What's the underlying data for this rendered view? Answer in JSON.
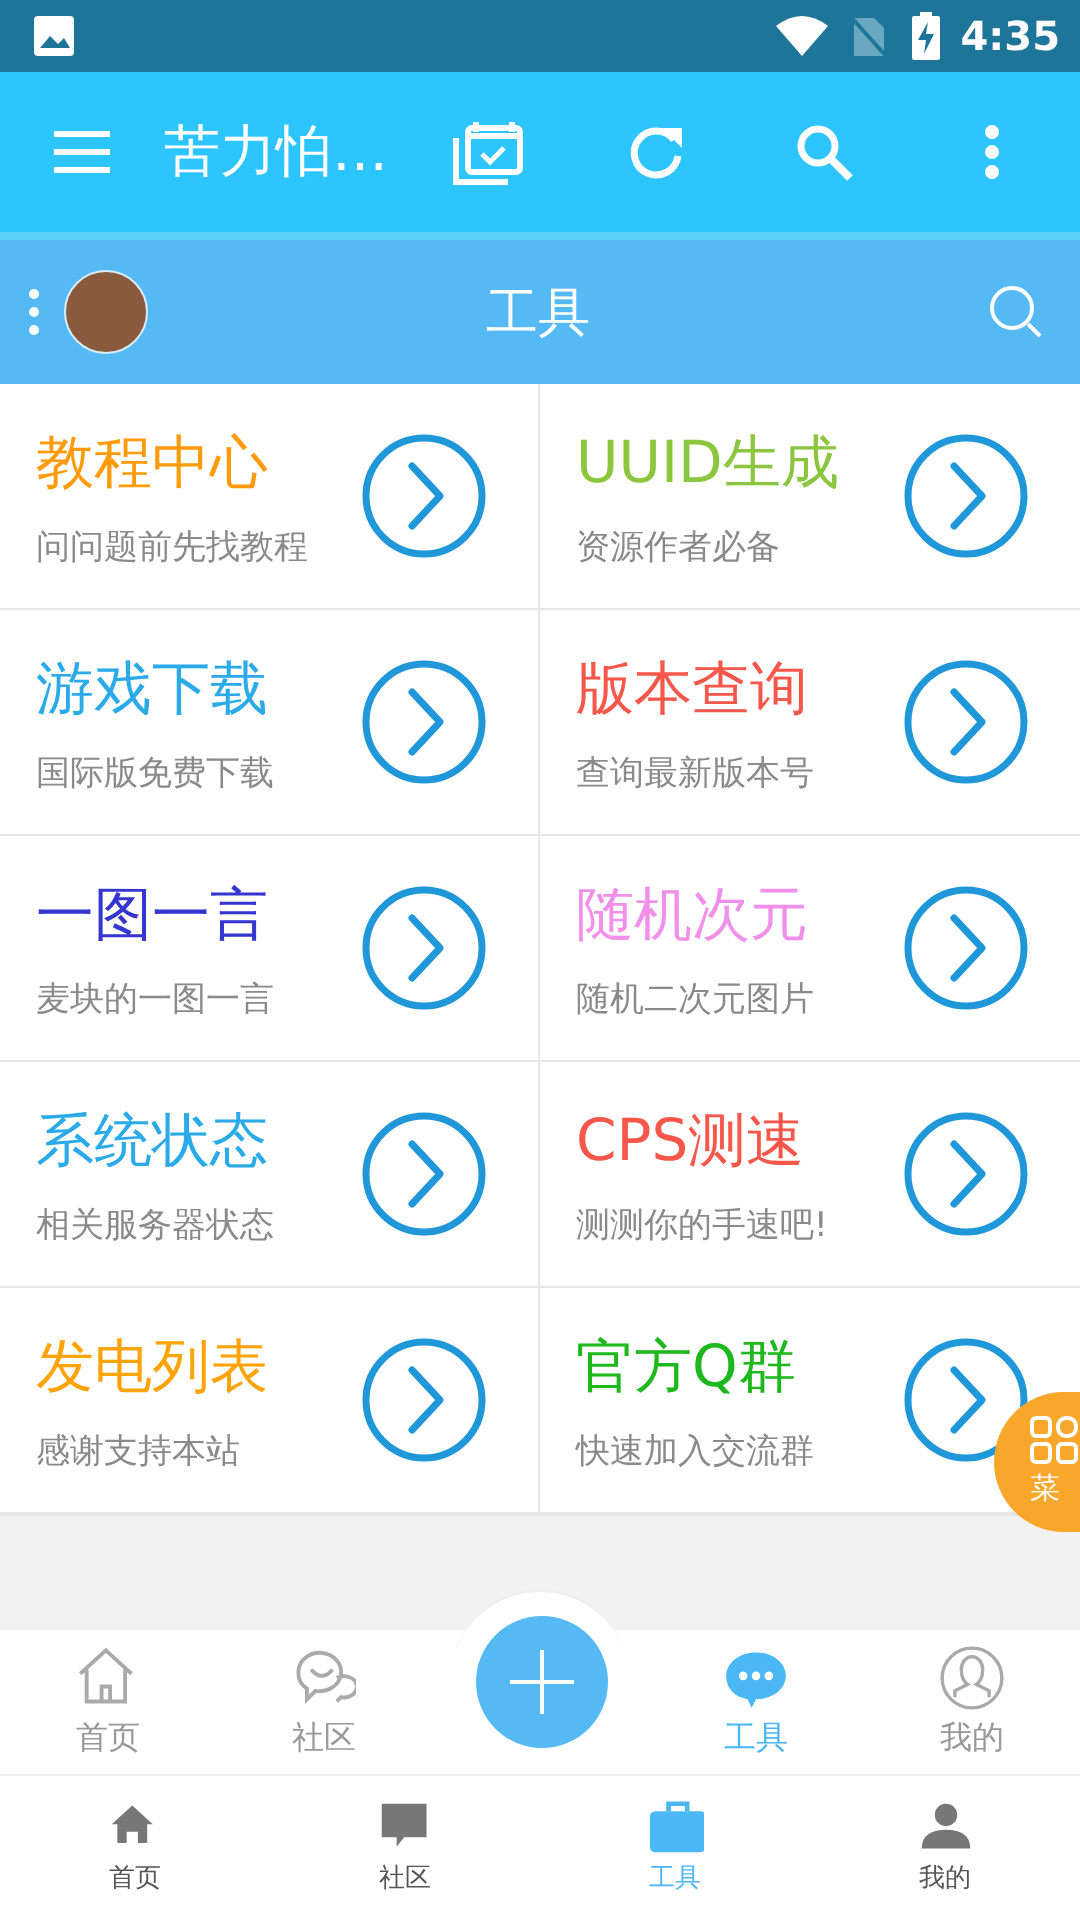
{
  "status_bar": {
    "time": "4:35"
  },
  "toolbar": {
    "title": "苦力怕…"
  },
  "sub_header": {
    "title": "工具"
  },
  "tools": [
    {
      "title": "教程中心",
      "subtitle": "问问题前先找教程",
      "color": "#ff9b0a"
    },
    {
      "title": "UUID生成",
      "subtitle": "资源作者必备",
      "color": "#8cc63f"
    },
    {
      "title": "游戏下载",
      "subtitle": "国际版免费下载",
      "color": "#2aaae8"
    },
    {
      "title": "版本查询",
      "subtitle": "查询最新版本号",
      "color": "#f5584a"
    },
    {
      "title": "一图一言",
      "subtitle": "麦块的一图一言",
      "color": "#3535d0"
    },
    {
      "title": "随机次元",
      "subtitle": "随机二次元图片",
      "color": "#f090ea"
    },
    {
      "title": "系统状态",
      "subtitle": "相关服务器状态",
      "color": "#2aaae8"
    },
    {
      "title": "CPS测速",
      "subtitle": "测测你的手速吧!",
      "color": "#f5584a"
    },
    {
      "title": "发电列表",
      "subtitle": "感谢支持本站",
      "color": "#ffa30a"
    },
    {
      "title": "官方Q群",
      "subtitle": "快速加入交流群",
      "color": "#1cb81c"
    }
  ],
  "floating_menu": {
    "label": "菜"
  },
  "tab_bar": [
    {
      "label": "首页",
      "kind": "home",
      "selected": false
    },
    {
      "label": "社区",
      "kind": "chat",
      "selected": false
    },
    {
      "label": "工具",
      "kind": "bubble",
      "selected": true
    },
    {
      "label": "我的",
      "kind": "user",
      "selected": false
    }
  ],
  "bottom_nav": [
    {
      "label": "首页",
      "kind": "home",
      "selected": false
    },
    {
      "label": "社区",
      "kind": "chat",
      "selected": false
    },
    {
      "label": "工具",
      "kind": "bag",
      "selected": true
    },
    {
      "label": "我的",
      "kind": "user",
      "selected": false
    }
  ]
}
